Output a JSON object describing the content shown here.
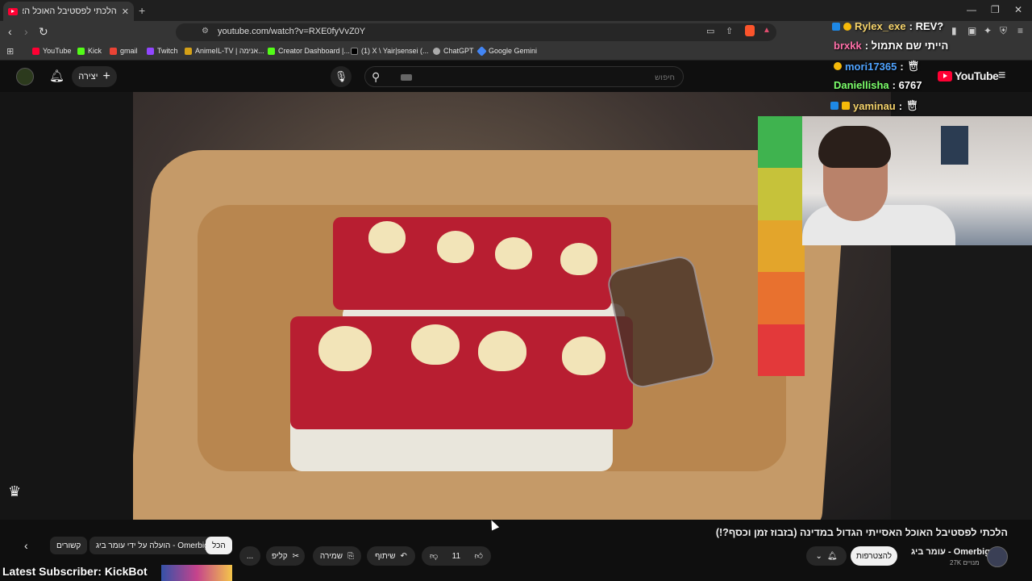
{
  "browser": {
    "tab_title": "הלכתי לפסטיבל האוכל האסייתי",
    "tab_close": "✕",
    "new_tab": "+",
    "url": "youtube.com/watch?v=RXE0fyVvZ0Y",
    "window_controls": [
      "—",
      "❐",
      "✕"
    ]
  },
  "bookmarks": [
    {
      "label": "YouTube",
      "color": "#ff0033"
    },
    {
      "label": "Kick",
      "color": "#53fc18"
    },
    {
      "label": "gmail",
      "color": "#ea4335"
    },
    {
      "label": "Twitch",
      "color": "#9146ff"
    },
    {
      "label": "AnimeIL-TV | אנימה...",
      "color": "#d4a017"
    },
    {
      "label": "Creator Dashboard |...",
      "color": "#53fc18"
    },
    {
      "label": "(1) X \\ Yair|sensei (...",
      "color": "#333333"
    },
    {
      "label": "ChatGPT",
      "color": "#aaaaaa"
    },
    {
      "label": "Google Gemini",
      "color": "#4285f4"
    }
  ],
  "header": {
    "create_label": "יצירה",
    "search_placeholder": "חיפוש",
    "logo_text": "YouTube"
  },
  "chat": [
    {
      "user": "Rylex_exe",
      "msg": ": REV?",
      "color": "#f5d36b"
    },
    {
      "user": "brxkk",
      "msg": ": הייתי שם אתמול",
      "color": "#ff6fa8"
    },
    {
      "user": "mori17365",
      "msg": ":",
      "color": "#4fa3ff"
    },
    {
      "user": "Daniellisha",
      "msg": ": 6767",
      "color": "#7cff6b"
    },
    {
      "user": "yaminau",
      "msg": ":",
      "color": "#f5d36b"
    }
  ],
  "cam_bar_colors": [
    "#3fb34f",
    "#c6c23a",
    "#e3a52b",
    "#e8712f",
    "#e3393a"
  ],
  "video_info": {
    "title": "הלכתי לפסטיבל האוכל האסייתי הגדול במדינה (בזבוז זמן וכסף?!)",
    "channel": "עומר ביג - Omerbig",
    "subscribers": "27K מנויים",
    "subscribe_label": "להצטרפות",
    "likes": "11",
    "share_label": "שיתוף",
    "save_label": "שמירה",
    "clip_label": "קליפ",
    "more": "..."
  },
  "chips": [
    {
      "label": "הכל",
      "active": true
    },
    {
      "label": "הועלה על ידי עומר ביג - Omerbig",
      "active": false
    },
    {
      "label": "קשורים",
      "active": false
    }
  ],
  "overlay": {
    "latest_subscriber": "Latest Subscriber: KickBot"
  }
}
